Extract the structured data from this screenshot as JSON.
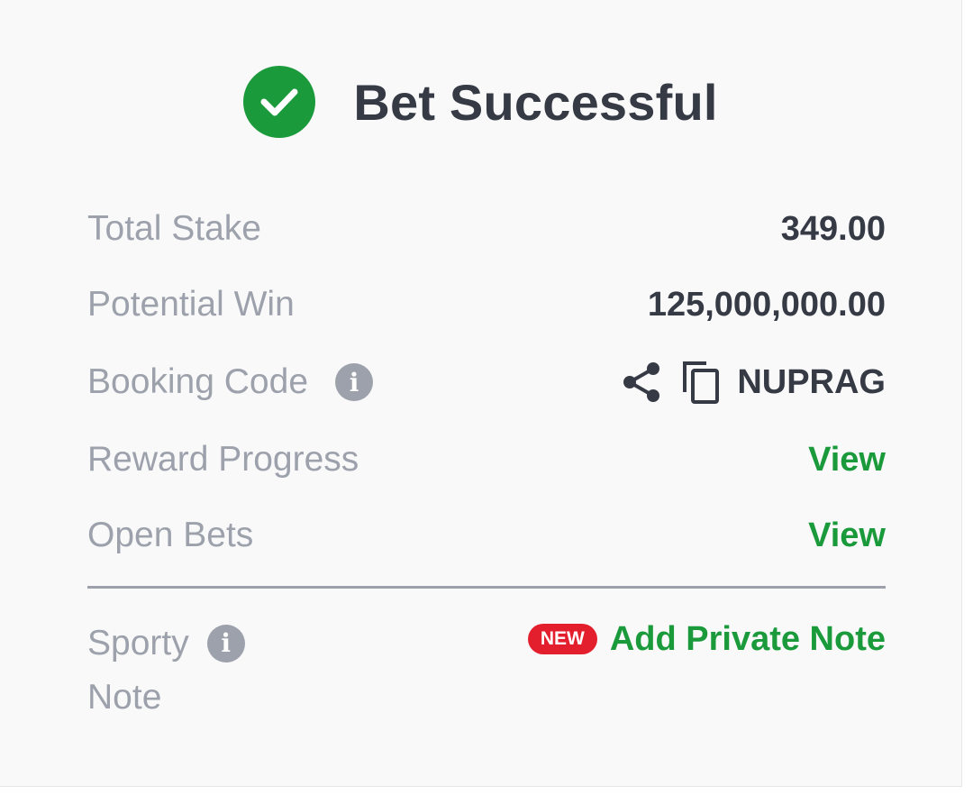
{
  "header": {
    "title": "Bet Successful",
    "icon": "check-circle-icon",
    "accent_color": "#1b9a3c"
  },
  "rows": {
    "total_stake": {
      "label": "Total Stake",
      "value": "349.00"
    },
    "potential_win": {
      "label": "Potential Win",
      "value": "125,000,000.00"
    },
    "booking_code": {
      "label": "Booking Code",
      "value": "NUPRAG"
    },
    "reward_progress": {
      "label": "Reward Progress",
      "action": "View"
    },
    "open_bets": {
      "label": "Open Bets",
      "action": "View"
    }
  },
  "note": {
    "label_line1": "Sporty",
    "label_line2": "Note",
    "badge": "NEW",
    "badge_color": "#e41f2d",
    "action": "Add Private Note"
  },
  "icons": {
    "info": "info-icon",
    "share": "share-icon",
    "copy": "copy-icon"
  }
}
